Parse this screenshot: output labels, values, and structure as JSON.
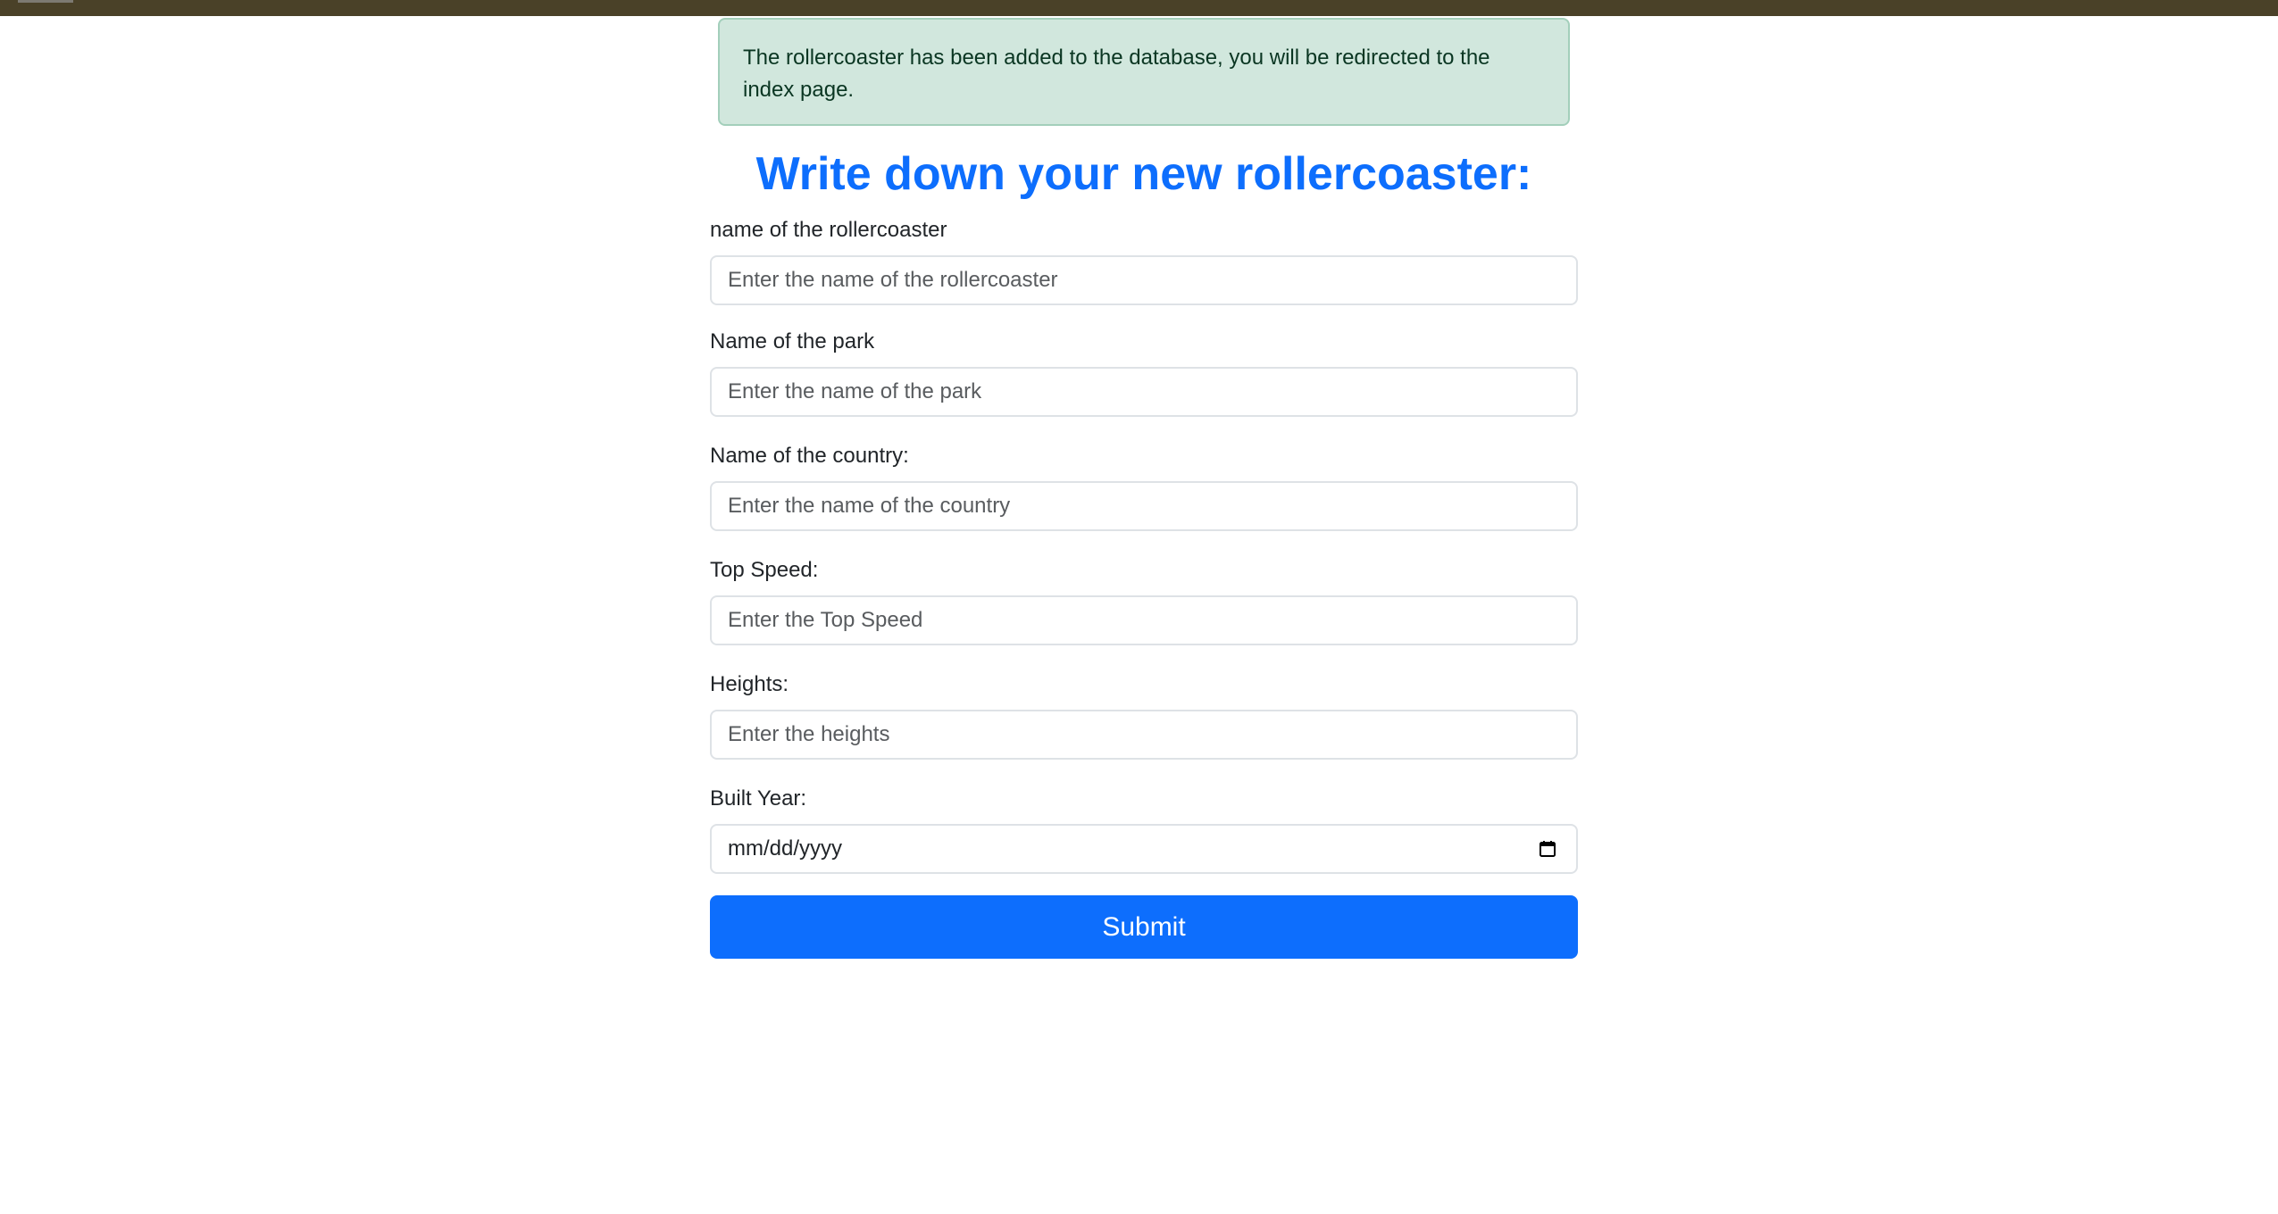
{
  "alert": {
    "message": "The rollercoaster has been added to the database, you will be redirected to the index page."
  },
  "form": {
    "title": "Write down your new rollercoaster:",
    "fields": [
      {
        "label": "name of the rollercoaster",
        "placeholder": "Enter the name of the rollercoaster",
        "value": ""
      },
      {
        "label": "Name of the park",
        "placeholder": "Enter the name of the park",
        "value": ""
      },
      {
        "label": "Name of the country:",
        "placeholder": "Enter the name of the country",
        "value": ""
      },
      {
        "label": "Top Speed:",
        "placeholder": "Enter the Top Speed",
        "value": ""
      },
      {
        "label": "Heights:",
        "placeholder": "Enter the heights",
        "value": ""
      }
    ],
    "built_year": {
      "label": "Built Year:",
      "placeholder": "mm/dd/yyyy",
      "icon": "calendar-icon"
    },
    "submit_label": "Submit"
  },
  "colors": {
    "top_bar": "#4a4128",
    "alert_bg": "#d1e7dd",
    "alert_border": "#a3cfbb",
    "alert_text": "#0a3622",
    "title": "#0d6efd",
    "submit_bg": "#0d6efd"
  }
}
